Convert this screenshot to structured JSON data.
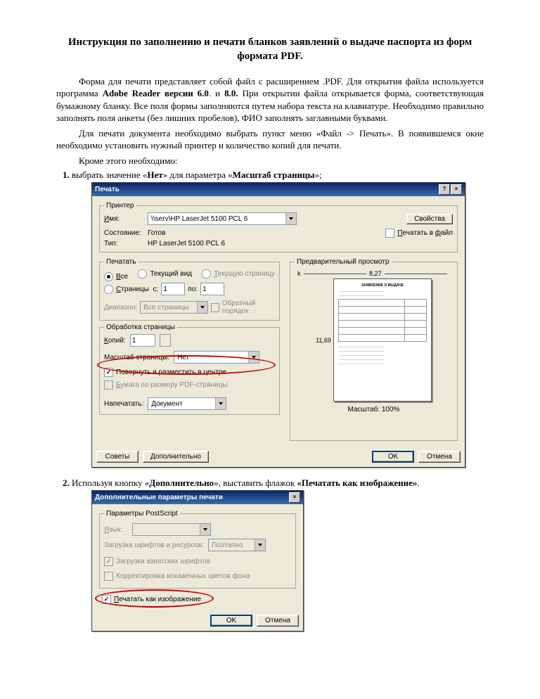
{
  "doc": {
    "title": "Инструкция по заполнению и печати бланков заявлений о выдаче паспорта из форм формата PDF.",
    "p1_a": "Форма для печати представляет собой файл с расширением .PDF. Для открытия файла используется программа ",
    "p1_b": "Adobe Reader версии 6.0",
    "p1_c": ". и ",
    "p1_d": "8.0.",
    "p1_e": " При открытии файла открывается форма, соответствующая бумажному бланку. Все поля формы заполняются путем набора текста на клавиатуре. Необходимо правильно заполнять поля анкеты (без лишних пробелов), ФИО заполнять заглавными буквами.",
    "p2": "Для печати документа необходимо выбрать пункт меню «Файл -> Печать». В появившемся окне необходимо установить нужный принтер и количество копий для печати.",
    "p3": "Кроме этого необходимо:",
    "step1_a": "выбрать значение «",
    "step1_b": "Нет",
    "step1_c": "» для параметра «",
    "step1_d": "Масштаб страницы",
    "step1_e": "»;",
    "step2_a": "Используя кнопку «",
    "step2_b": "Дополнительно",
    "step2_c": "», выставить флажок ",
    "step2_d": "«Печатать как изображение»",
    "step2_e": "."
  },
  "dlg1": {
    "title": "Печать",
    "printer_group": "Принтер",
    "name_lbl": "Имя:",
    "name_val": "\\\\serv\\HP LaserJet 5100 PCL 6",
    "props_btn": "Свойства",
    "status_lbl": "Состояние:",
    "status_val": "Готов",
    "type_lbl": "Тип:",
    "type_val": "HP LaserJet 5100 PCL 6",
    "print_to_file": "Печатать в файл",
    "range_group": "Печатать",
    "r_all": "Все",
    "r_current": "Текущий вид",
    "r_curpage": "Текущую страницу",
    "r_pages": "Страницы  с:",
    "r_pages_to": "по:",
    "r_from_val": "1",
    "r_to_val": "1",
    "subset_lbl": "Диапазон:",
    "subset_val": "Все страницы",
    "reverse": "Обратный порядок",
    "handling_group": "Обработка страницы",
    "copies_lbl": "Копий:",
    "copies_val": "1",
    "scale_lbl": "Масштаб страницы:",
    "scale_val": "Нет",
    "rotate": "Повернуть и разместить в центре",
    "paper_by_pdf": "Бумага по размеру PDF-страницы",
    "what_lbl": "Напечатать:",
    "what_val": "Документ",
    "preview_group": "Предварительный просмотр",
    "width": "8,27",
    "height": "11,69",
    "zoom": "Масштаб: 100%",
    "tips_btn": "Советы",
    "adv_btn": "Дополнительно",
    "ok_btn": "OK",
    "cancel_btn": "Отмена"
  },
  "dlg2": {
    "title": "Дополнительные параметры печати",
    "ps_group": "Параметры PostScript",
    "lang_lbl": "Язык:",
    "fonts_lbl": "Загрузка шрифтов и ресурсов:",
    "fonts_val": "Поэтапно",
    "asian": "Загрузка азиатских шрифтов",
    "correct": "Корректировка искаженных цветов фона",
    "as_image": "Печатать как изображение",
    "ok_btn": "OK",
    "cancel_btn": "Отмена"
  }
}
